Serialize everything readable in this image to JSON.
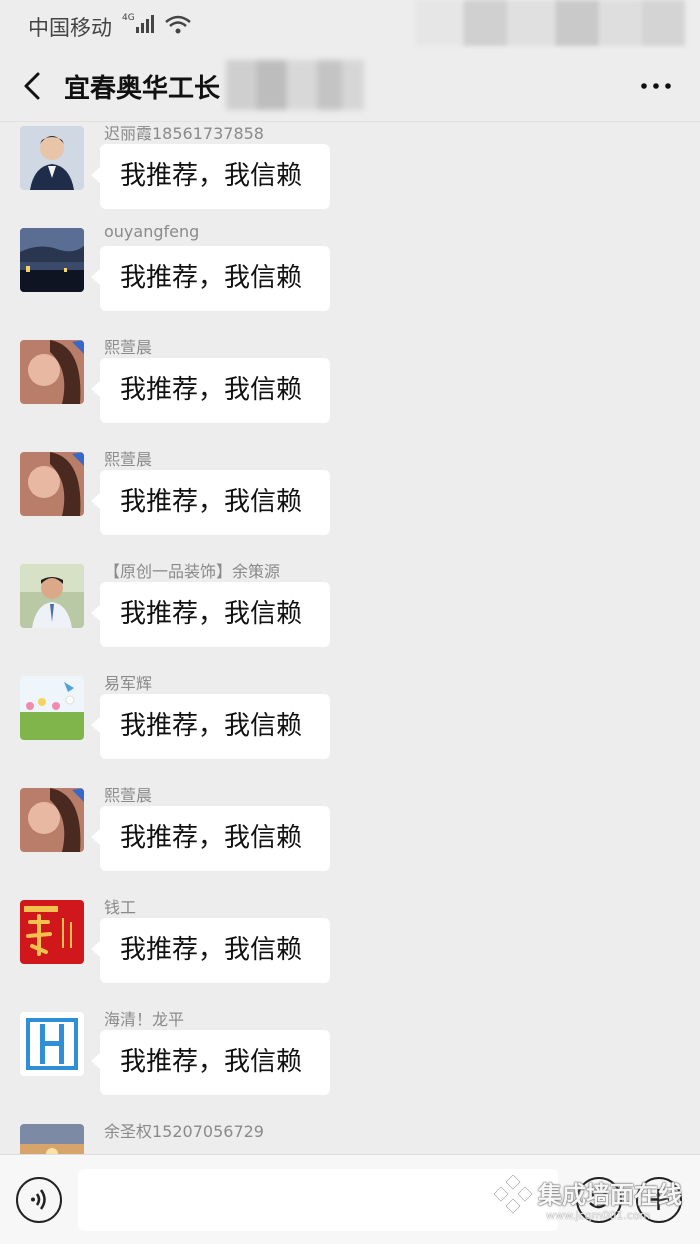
{
  "status_bar": {
    "carrier": "中国移动",
    "network_type": "4G"
  },
  "header": {
    "title": "宜春奥华工长"
  },
  "messages": [
    {
      "sender": "迟丽霞18561737858",
      "text": "我推荐，我信赖",
      "avatar": "woman-in-blazer-avatar"
    },
    {
      "sender": "ouyangfeng",
      "text": "我推荐，我信赖",
      "avatar": "night-sky-avatar"
    },
    {
      "sender": "熙萱晨",
      "text": "我推荐，我信赖",
      "avatar": "woman-portrait-avatar"
    },
    {
      "sender": "熙萱晨",
      "text": "我推荐，我信赖",
      "avatar": "woman-portrait-avatar"
    },
    {
      "sender": "【原创一品装饰】余策源",
      "text": "我推荐，我信赖",
      "avatar": "man-portrait-avatar"
    },
    {
      "sender": "易军辉",
      "text": "我推荐，我信赖",
      "avatar": "flower-field-avatar"
    },
    {
      "sender": "熙萱晨",
      "text": "我推荐，我信赖",
      "avatar": "woman-portrait-avatar"
    },
    {
      "sender": "钱工",
      "text": "我推荐，我信赖",
      "avatar": "red-calligraphy-avatar"
    },
    {
      "sender": "海清！龙平",
      "text": "我推荐，我信赖",
      "avatar": "blue-h-logo-avatar"
    },
    {
      "sender": "余圣权15207056729",
      "text": "",
      "avatar": "sunset-avatar"
    }
  ],
  "input_bar": {
    "value": ""
  },
  "watermark": {
    "text": "集成墙面在线",
    "sub": "www.jcqm001.com"
  },
  "colors": {
    "background": "#ededed",
    "bubble": "#ffffff",
    "sender_name": "#8a8a8a"
  }
}
